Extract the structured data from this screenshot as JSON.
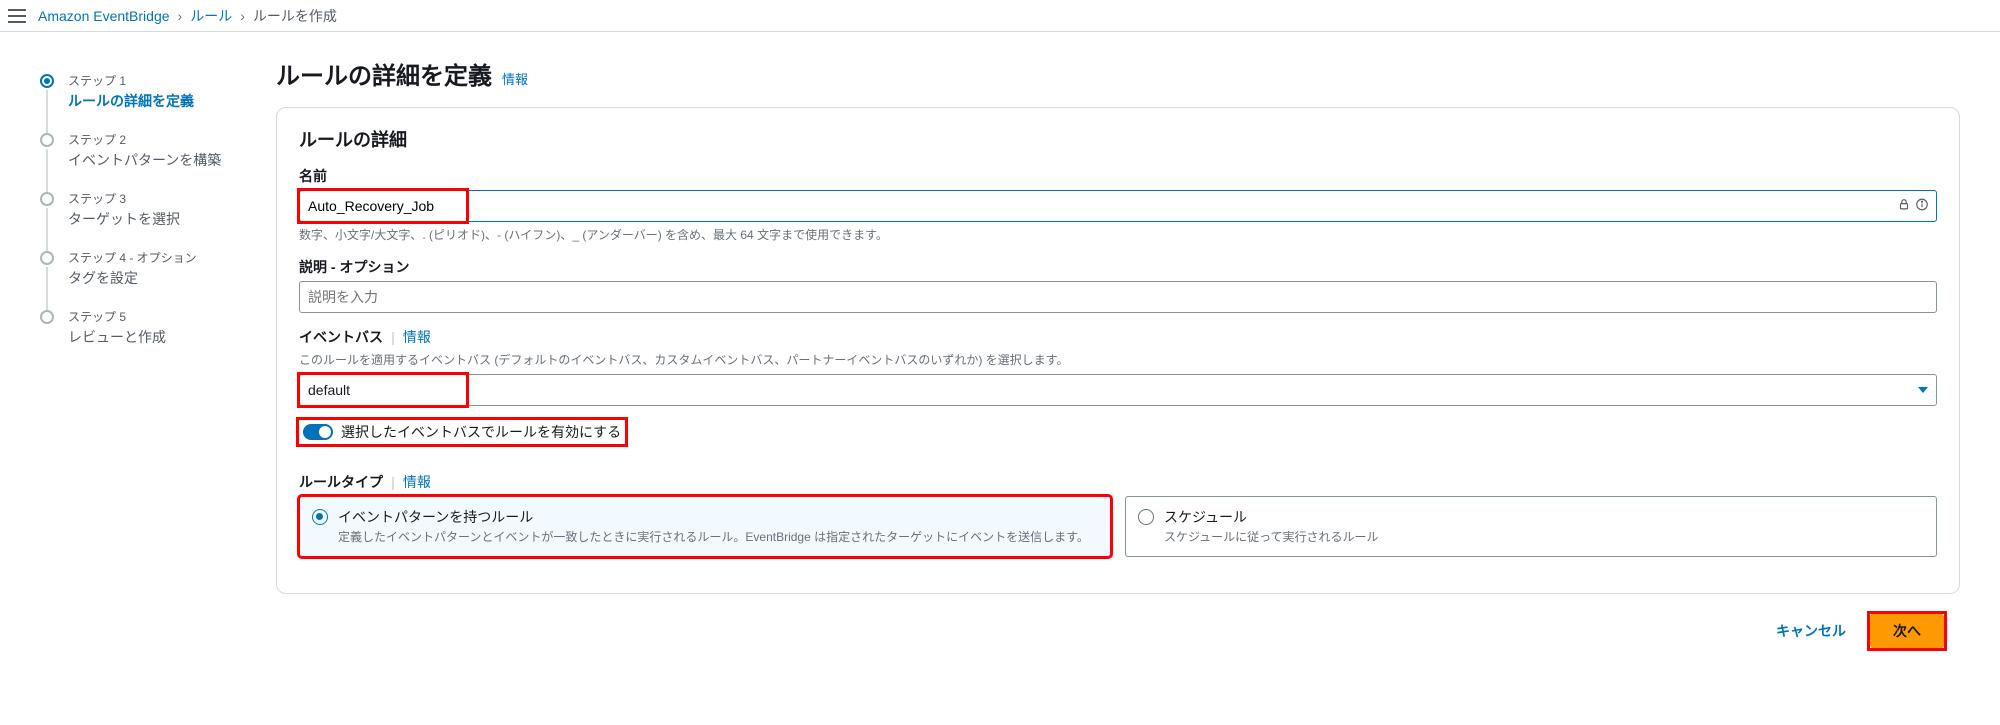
{
  "breadcrumb": {
    "items": [
      "Amazon EventBridge",
      "ルール",
      "ルールを作成"
    ]
  },
  "stepper": [
    {
      "label": "ステップ 1",
      "title": "ルールの詳細を定義"
    },
    {
      "label": "ステップ 2",
      "title": "イベントパターンを構築"
    },
    {
      "label": "ステップ 3",
      "title": "ターゲットを選択"
    },
    {
      "label": "ステップ 4 - オプション",
      "title": "タグを設定"
    },
    {
      "label": "ステップ 5",
      "title": "レビューと作成"
    }
  ],
  "page": {
    "title": "ルールの詳細を定義",
    "info": "情報"
  },
  "panel": {
    "heading": "ルールの詳細",
    "name": {
      "label": "名前",
      "value": "Auto_Recovery_Job",
      "hint": "数字、小文字/大文字、. (ピリオド)、- (ハイフン)、_ (アンダーバー) を含め、最大 64 文字まで使用できます。"
    },
    "description": {
      "label": "説明 - オプション",
      "placeholder": "説明を入力"
    },
    "eventbus": {
      "label": "イベントバス",
      "info": "情報",
      "sub": "このルールを適用するイベントバス (デフォルトのイベントバス、カスタムイベントバス、パートナーイベントバスのいずれか) を選択します。",
      "value": "default"
    },
    "toggle": {
      "label": "選択したイベントバスでルールを有効にする"
    },
    "ruletype": {
      "label": "ルールタイプ",
      "info": "情報",
      "options": [
        {
          "title": "イベントパターンを持つルール",
          "desc": "定義したイベントパターンとイベントが一致したときに実行されるルール。EventBridge は指定されたターゲットにイベントを送信します。"
        },
        {
          "title": "スケジュール",
          "desc": "スケジュールに従って実行されるルール"
        }
      ]
    }
  },
  "footer": {
    "cancel": "キャンセル",
    "next": "次へ"
  }
}
